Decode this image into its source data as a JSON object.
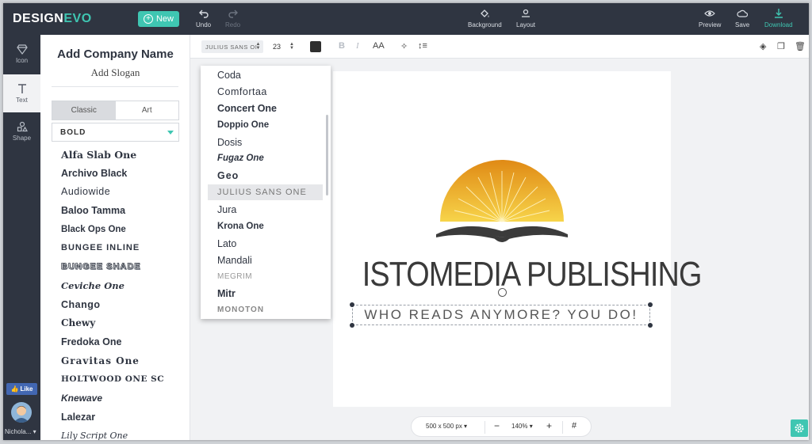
{
  "brand": {
    "name_part1": "DESIGN",
    "name_part2": "EVO"
  },
  "topbar": {
    "new_label": "New",
    "undo_label": "Undo",
    "redo_label": "Redo",
    "background_label": "Background",
    "layout_label": "Layout",
    "preview_label": "Preview",
    "save_label": "Save",
    "download_label": "Download"
  },
  "rail": {
    "icon_label": "Icon",
    "text_label": "Text",
    "shape_label": "Shape",
    "like_label": "Like",
    "username": "Nichola..."
  },
  "panel": {
    "company_name": "Add Company Name",
    "slogan": "Add Slogan",
    "tabs": [
      "Classic",
      "Art"
    ],
    "active_tab": "Classic",
    "category": "BOLD",
    "fonts": [
      "Alfa Slab One",
      "Archivo Black",
      "Audiowide",
      "Baloo Tamma",
      "Black Ops One",
      "BUNGEE INLINE",
      "BUNGEE SHADE",
      "Ceviche One",
      "Chango",
      "Chewy",
      "Fredoka One",
      "Gravitas One",
      "HOLTWOOD ONE SC",
      "Knewave",
      "Lalezar",
      "Lily Script One"
    ]
  },
  "text_toolbar": {
    "font": "JULIUS SANS OI",
    "size": "23",
    "color": "#2f2f2f"
  },
  "font_dropdown": {
    "items": [
      "Coda",
      "Comfortaa",
      "Concert One",
      "Doppio One",
      "Dosis",
      "Fugaz One",
      "Geo",
      "JULIUS SANS ONE",
      "Jura",
      "Krona One",
      "Lato",
      "Mandali",
      "MEGRIM",
      "Mitr",
      "MONOTON"
    ],
    "selected": "JULIUS SANS ONE"
  },
  "canvas": {
    "title": "ISTOMEDIA PUBLISHING",
    "tagline": "WHO READS ANYMORE? YOU DO!"
  },
  "bottom": {
    "size": "500 x 500 px",
    "zoom": "140%"
  },
  "colors": {
    "accent": "#3fc6b2",
    "dark": "#2f3541",
    "sun_top": "#e8a020",
    "sun_bottom": "#f7d44a"
  }
}
